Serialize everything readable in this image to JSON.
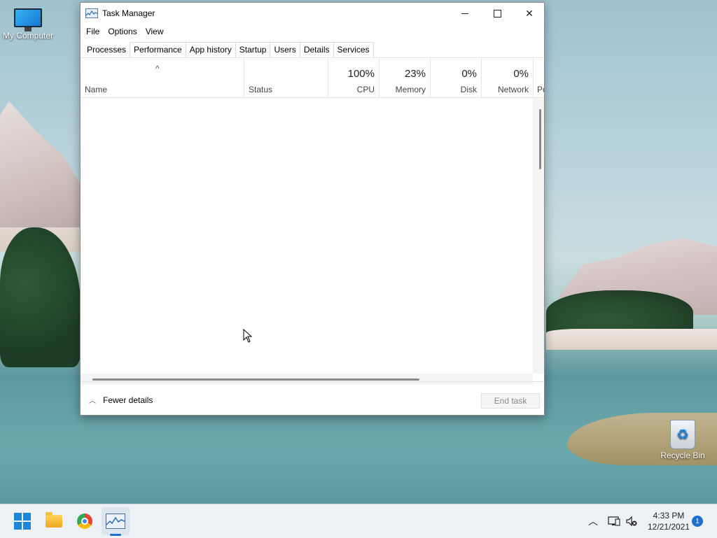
{
  "desktop": {
    "icons": [
      {
        "label": "My Computer"
      },
      {
        "label": "Recycle Bin"
      }
    ]
  },
  "window": {
    "title": "Task Manager",
    "controls": {
      "minimize": "—",
      "maximize": "☐",
      "close": "✕"
    },
    "menu": [
      "File",
      "Options",
      "View"
    ],
    "tabs": [
      "Processes",
      "Performance",
      "App history",
      "Startup",
      "Users",
      "Details",
      "Services"
    ],
    "active_tab": "Processes",
    "columns": [
      {
        "name": "Name",
        "value": ""
      },
      {
        "name": "Status",
        "value": ""
      },
      {
        "name": "CPU",
        "value": "100%"
      },
      {
        "name": "Memory",
        "value": "23%"
      },
      {
        "name": "Disk",
        "value": "0%"
      },
      {
        "name": "Network",
        "value": "0%"
      },
      {
        "name": "Po",
        "value": ""
      }
    ],
    "sort_indicator": "^",
    "footer": {
      "fewer_details": "Fewer details",
      "end_task": "End task"
    }
  },
  "taskbar": {
    "clock_time": "4:33 PM",
    "clock_date": "12/21/2021",
    "notification_count": "1",
    "tray_chevron": "^"
  },
  "colors": {
    "accent": "#1f6fcf",
    "window_bg": "#ffffff",
    "taskbar_bg": "#eef1f5"
  }
}
